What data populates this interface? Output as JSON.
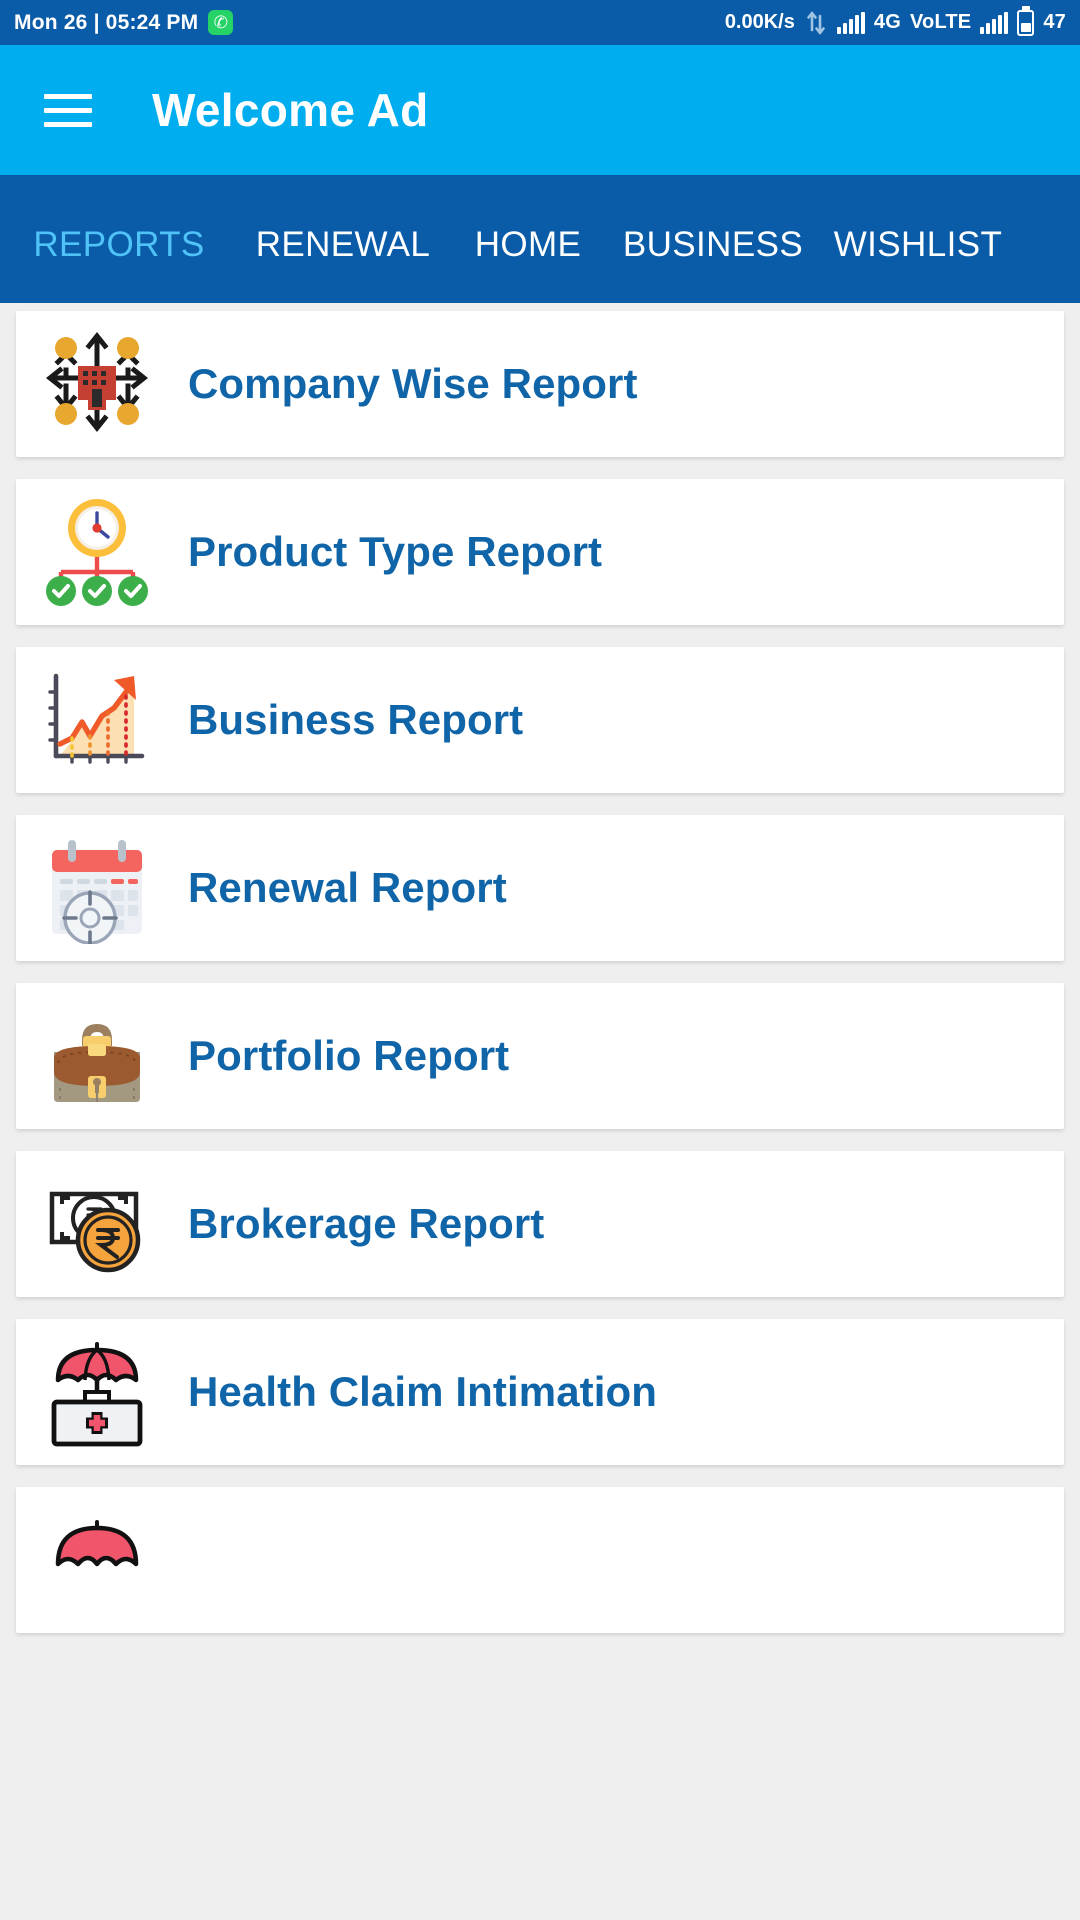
{
  "statusbar": {
    "clock": "Mon 26 | 05:24 PM",
    "whatsapp_icon": "whatsapp-icon",
    "net_speed": "0.00K/s",
    "sync_icon": "sync-arrows-icon",
    "signal1_icon": "signal-bars-icon",
    "network_type": "4G",
    "volte": "VoLTE",
    "signal2_icon": "signal-bars-icon",
    "battery_icon": "battery-icon",
    "battery_level": "47"
  },
  "appbar": {
    "menu_icon": "hamburger-menu-icon",
    "title": "Welcome Ad"
  },
  "tabs": [
    {
      "label": "REPORTS",
      "active": true
    },
    {
      "label": "RENEWAL",
      "active": false
    },
    {
      "label": "HOME",
      "active": false
    },
    {
      "label": "BUSINESS",
      "active": false
    },
    {
      "label": "WISHLIST",
      "active": false
    }
  ],
  "reports": [
    {
      "label": "Company Wise Report",
      "icon": "org-chart-building-icon"
    },
    {
      "label": "Product Type Report",
      "icon": "clock-checklist-icon"
    },
    {
      "label": "Business Report",
      "icon": "growth-line-chart-icon"
    },
    {
      "label": "Renewal Report",
      "icon": "calendar-clock-icon"
    },
    {
      "label": "Portfolio Report",
      "icon": "briefcase-icon"
    },
    {
      "label": "Brokerage Report",
      "icon": "rupee-money-icon"
    },
    {
      "label": "Health Claim Intimation",
      "icon": "umbrella-medical-kit-icon"
    },
    {
      "label": "",
      "icon": "umbrella-icon"
    }
  ],
  "colors": {
    "statusbar_bg": "#0A5CA8",
    "appbar_bg": "#00AEEF",
    "tabbar_bg": "#0A5CA8",
    "tab_active": "#4FC3F7",
    "page_bg": "#EFEFEF",
    "card_bg": "#FFFFFF",
    "label_blue": "#1064A8"
  }
}
